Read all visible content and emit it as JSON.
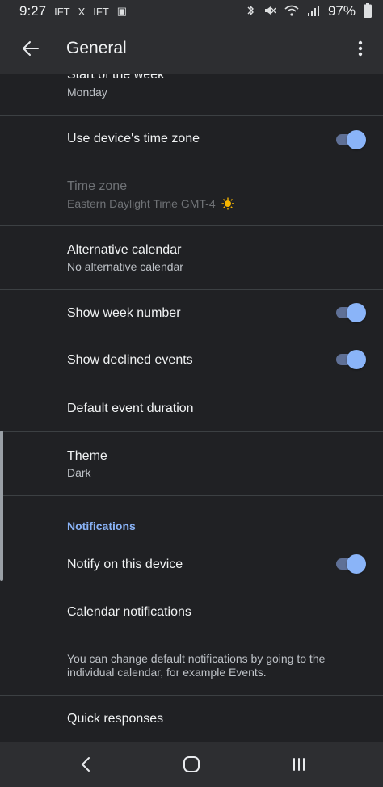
{
  "status_bar": {
    "time": "9:27",
    "left_icons": [
      "IFT",
      "X",
      "IFT",
      "▣"
    ],
    "right_icons": [
      "✱",
      "✖",
      "wifi",
      "signal"
    ],
    "battery": "97%"
  },
  "app_bar": {
    "title": "General"
  },
  "rows": {
    "start_of_week": {
      "label": "Start of the week",
      "value": "Monday"
    },
    "device_timezone": {
      "label": "Use device's time zone",
      "enabled": true
    },
    "time_zone": {
      "label": "Time zone",
      "value": "Eastern Daylight Time  GMT-4"
    },
    "alt_calendar": {
      "label": "Alternative calendar",
      "value": "No alternative calendar"
    },
    "week_number": {
      "label": "Show week number",
      "enabled": true
    },
    "declined_events": {
      "label": "Show declined events",
      "enabled": true
    },
    "default_duration": {
      "label": "Default event duration"
    },
    "theme": {
      "label": "Theme",
      "value": "Dark"
    },
    "notifications_header": "Notifications",
    "notify_device": {
      "label": "Notify on this device",
      "enabled": true
    },
    "calendar_notifications": {
      "label": "Calendar notifications"
    },
    "help_text": "You can change default notifications by going to the individual calendar, for example Events.",
    "quick_responses": {
      "label": "Quick responses"
    }
  },
  "colors": {
    "background": "#202124",
    "bar": "#2d2e31",
    "accent": "#8ab4f8"
  }
}
